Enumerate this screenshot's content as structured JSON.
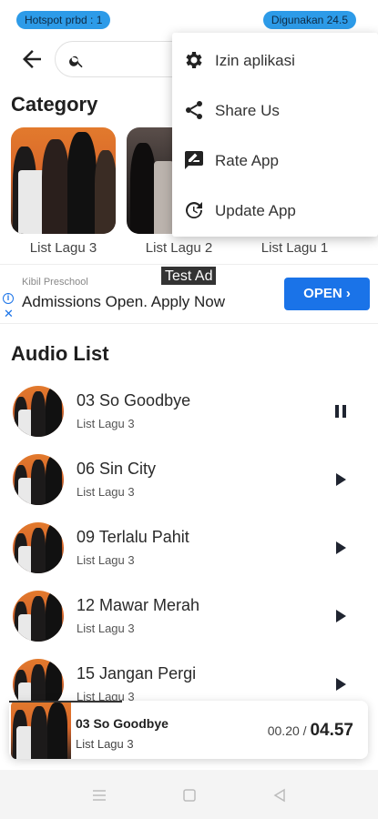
{
  "status": {
    "hotspot": "Hotspot prbd : 1",
    "usage": "Digunakan 24.5"
  },
  "search": {
    "placeholder": ""
  },
  "category": {
    "title": "Category",
    "items": [
      {
        "label": "List Lagu 3"
      },
      {
        "label": "List Lagu 2"
      },
      {
        "label": "List Lagu 1"
      }
    ]
  },
  "ad": {
    "advertiser": "Kibil Preschool",
    "headline": "Admissions Open. Apply Now",
    "cta": "OPEN",
    "test_label": "Test Ad",
    "info_icon": "info-icon",
    "close_icon": "close-icon"
  },
  "audio": {
    "title": "Audio List",
    "tracks": [
      {
        "title": "03 So Goodbye",
        "list": "List Lagu 3",
        "state": "playing"
      },
      {
        "title": "06 Sin City",
        "list": "List Lagu 3",
        "state": "paused"
      },
      {
        "title": "09 Terlalu Pahit",
        "list": "List Lagu 3",
        "state": "paused"
      },
      {
        "title": "12 Mawar Merah",
        "list": "List Lagu 3",
        "state": "paused"
      },
      {
        "title": "15 Jangan Pergi",
        "list": "List Lagu 3",
        "state": "paused"
      }
    ]
  },
  "player": {
    "title": "03 So Goodbye",
    "list": "List Lagu 3",
    "elapsed": "00.20",
    "separator": "/",
    "duration": "04.57"
  },
  "menu": {
    "items": [
      {
        "label": "Izin aplikasi",
        "icon": "gear-icon"
      },
      {
        "label": "Share Us",
        "icon": "share-icon"
      },
      {
        "label": "Rate App",
        "icon": "rate-icon"
      },
      {
        "label": "Update App",
        "icon": "update-icon"
      }
    ]
  },
  "colors": {
    "status_pill": "#2d9be8",
    "ad_button": "#1a73e8",
    "album_orange": "#e27a2d"
  }
}
